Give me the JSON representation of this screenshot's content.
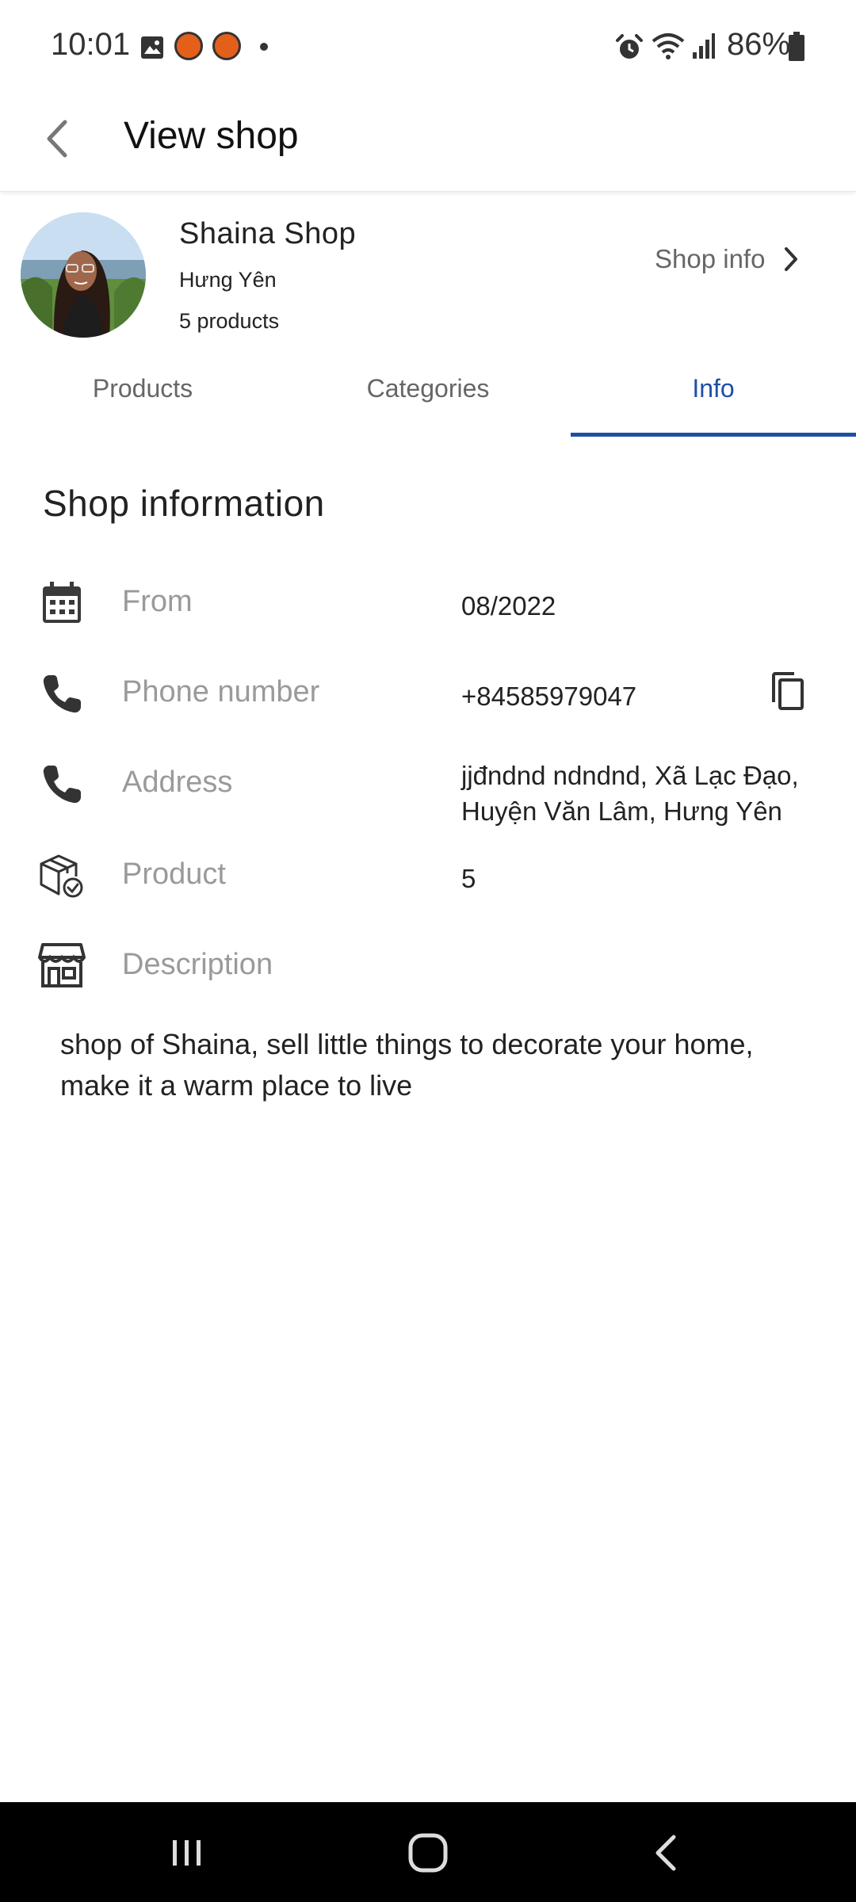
{
  "status_bar": {
    "time": "10:01",
    "battery": "86%",
    "icons": [
      "gallery-icon",
      "notification-badge-icon",
      "notification-badge-icon",
      "dot-icon",
      "alarm-icon",
      "wifi-icon",
      "signal-icon",
      "battery-icon"
    ]
  },
  "app_bar": {
    "title": "View shop",
    "back_icon": "back-arrow-icon"
  },
  "shop": {
    "name": "Shaina Shop",
    "location": "Hưng Yên",
    "product_count": "5 products",
    "info_link": "Shop info",
    "info_link_icon": "chevron-right-icon"
  },
  "tabs": [
    {
      "label": "Products",
      "active": false
    },
    {
      "label": "Categories",
      "active": false
    },
    {
      "label": "Info",
      "active": true
    }
  ],
  "info": {
    "title": "Shop information",
    "rows": [
      {
        "icon": "calendar-icon",
        "label": "From",
        "value": "08/2022"
      },
      {
        "icon": "phone-icon",
        "label": "Phone number",
        "value": "+84585979047",
        "action_icon": "copy-icon"
      },
      {
        "icon": "phone-icon",
        "label": "Address",
        "value": "jjđndnd ndndnd, Xã Lạc Đạo, Huyện Văn Lâm, Hưng Yên"
      },
      {
        "icon": "box-check-icon",
        "label": "Product",
        "value": "5"
      },
      {
        "icon": "storefront-icon",
        "label": "Description",
        "value": ""
      }
    ],
    "description": "shop of Shaina, sell little things to decorate your home, make it a warm place to live"
  },
  "colors": {
    "accent": "#1c4fa6",
    "label_gray": "#9a9a9a",
    "nav_bar": "#000000"
  }
}
